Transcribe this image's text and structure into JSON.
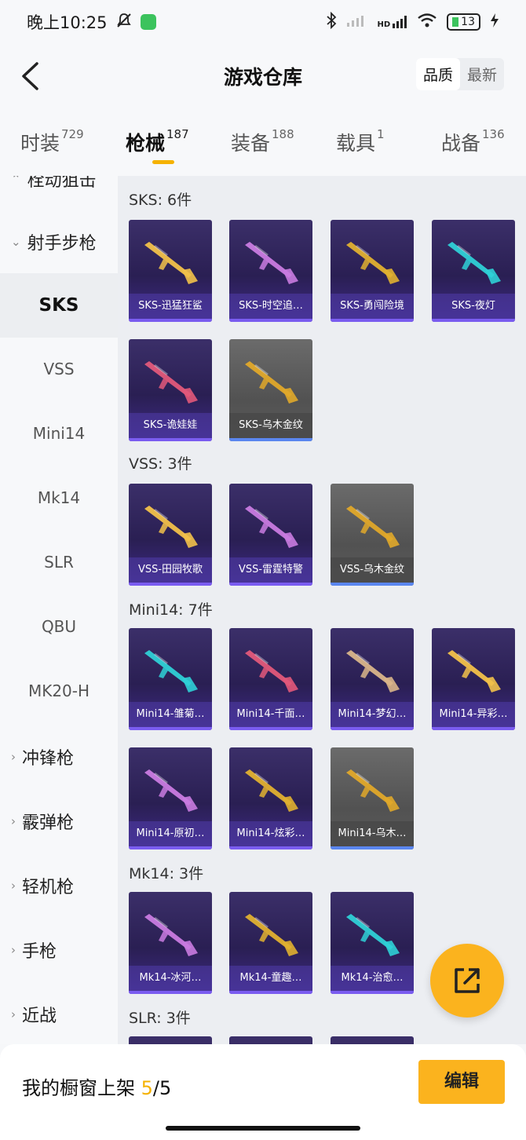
{
  "status": {
    "time": "晚上10:25",
    "network": "HD",
    "battery": "13"
  },
  "header": {
    "title": "游戏仓库",
    "sort_quality": "品质",
    "sort_newest": "最新"
  },
  "tabs": [
    {
      "label": "时装",
      "count": "729"
    },
    {
      "label": "枪械",
      "count": "187"
    },
    {
      "label": "装备",
      "count": "188"
    },
    {
      "label": "载具",
      "count": "1"
    },
    {
      "label": "战备",
      "count": "136"
    }
  ],
  "sidebar": {
    "cat_partial": "栓动狙击",
    "cat_dmr": "射手步枪",
    "subs": [
      "SKS",
      "VSS",
      "Mini14",
      "Mk14",
      "SLR",
      "QBU",
      "MK20-H"
    ],
    "cats": [
      "冲锋枪",
      "霰弹枪",
      "轻机枪",
      "手枪",
      "近战"
    ]
  },
  "groups": {
    "sks": {
      "title": "SKS: 6件",
      "items": [
        "SKS-迅猛狂鲨",
        "SKS-时空追…",
        "SKS-勇闯险境",
        "SKS-夜灯",
        "SKS-诡娃娃",
        "SKS-乌木金纹"
      ]
    },
    "vss": {
      "title": "VSS: 3件",
      "items": [
        "VSS-田园牧歌",
        "VSS-雷霆特警",
        "VSS-乌木金纹"
      ]
    },
    "mini14": {
      "title": "Mini14: 7件",
      "items": [
        "Mini14-雏菊…",
        "Mini14-千面…",
        "Mini14-梦幻…",
        "Mini14-异彩…",
        "Mini14-原初…",
        "Mini14-炫彩…",
        "Mini14-乌木…"
      ]
    },
    "mk14": {
      "title": "Mk14: 3件",
      "items": [
        "Mk14-冰河…",
        "Mk14-童趣…",
        "Mk14-治愈…"
      ]
    },
    "slr": {
      "title": "SLR: 3件"
    }
  },
  "bottom": {
    "showcase_label": "我的橱窗上架",
    "showcase_count": "5",
    "showcase_total": "/5",
    "edit_label": "编辑"
  },
  "colors": {
    "accent": "#fbb31e",
    "card_purple": "#3b2f69",
    "card_grey": "#6b6b6b"
  }
}
